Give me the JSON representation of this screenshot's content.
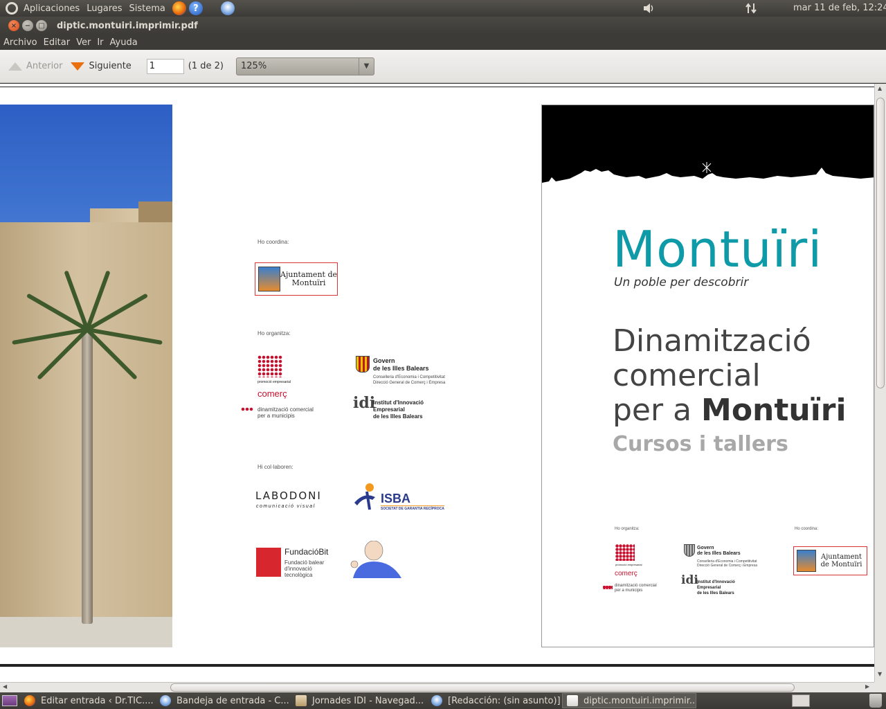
{
  "top_panel": {
    "menus": [
      "Aplicaciones",
      "Lugares",
      "Sistema"
    ],
    "help_icon_glyph": "?",
    "clock": "mar 11 de feb, 12:24"
  },
  "window": {
    "title": "diptic.montuiri.imprimir.pdf",
    "close_glyph": "×",
    "min_glyph": "−",
    "max_glyph": "□"
  },
  "menu_bar": [
    "Archivo",
    "Editar",
    "Ver",
    "Ir",
    "Ayuda"
  ],
  "toolbar": {
    "prev_label": "Anterior",
    "next_label": "Siguiente",
    "page_value": "1",
    "page_count": "(1 de 2)",
    "zoom": "125%",
    "zoom_arrow_glyph": "▼"
  },
  "left_page": {
    "coordina_label": "Ho coordina:",
    "ajuntament_logo_text": "Ajuntament de Montuïri",
    "organitza_label": "Ho organitza:",
    "promocio": "promoció empresarial",
    "comerc": "comerç",
    "dinamitzacio_small_1": "dinamització comercial",
    "dinamitzacio_small_2": "per a municipis",
    "govern_1": "Govern",
    "govern_2": "de les Illes Balears",
    "conselleria": "Conselleria d'Economia i Competitivitat",
    "direccio": "Direcció General de Comerç i Empresa",
    "idi_mark": "idi",
    "idi_1": "Institut d'Innovació",
    "idi_2": "Empresarial",
    "idi_3": "de les Illes Balears",
    "col_label": "Hi col·laboren:",
    "labodoni": "LABODONI",
    "labodoni_sub": "comunicació visual",
    "isba": "ISBA",
    "isba_sub": "SOCIETAT DE GARANTIA RECÍPROCA",
    "fundaciobit": "FundacióBit",
    "fundaciobit_sub_1": "Fundació balear",
    "fundaciobit_sub_2": "d'innovació",
    "fundaciobit_sub_3": "tecnològica"
  },
  "cover": {
    "title": "Montuïri",
    "subtitle": "Un poble per descobrir",
    "line1": "Dinamització",
    "line2": "comercial",
    "line3_pre": "per a ",
    "line3_bold": "Montuïri",
    "cursos": "Cursos i tallers",
    "organitza_label": "Ho organitza:",
    "coordina_label": "Ho coordina:",
    "promocio": "promoció empresarial",
    "comerc": "comerç",
    "dinamitzacio_small_1": "dinamització comercial",
    "dinamitzacio_small_2": "per a municipis",
    "govern_1": "Govern",
    "govern_2": "de les Illes Balears",
    "conselleria": "Conselleria d'Economia i Competitivitat",
    "direccio": "Direcció General de Comerç i Empresa",
    "idi_mark": "idi",
    "idi_1": "Institut d'Innovació",
    "idi_2": "Empresarial",
    "idi_3": "de les Illes Balears",
    "ajuntament_logo_text": "Ajuntament de Montuïri"
  },
  "scrollbars": {
    "up_glyph": "▲",
    "down_glyph": "▼",
    "left_glyph": "◀",
    "right_glyph": "▶"
  },
  "taskbar": [
    {
      "label": "Editar entrada ‹ Dr.TIC....",
      "icon": "firefox-icon",
      "active": false
    },
    {
      "label": "Bandeja de entrada - C...",
      "icon": "thunderbird-icon",
      "active": false
    },
    {
      "label": "Jornades IDI - Navegad...",
      "icon": "file-browser-icon",
      "active": false
    },
    {
      "label": "[Redacción: (sin asunto)]",
      "icon": "thunderbird-icon",
      "active": false
    },
    {
      "label": "diptic.montuiri.imprimir....",
      "icon": "document-viewer-icon",
      "active": true
    }
  ],
  "colors": {
    "montuiri_teal": "#0f9aa8",
    "comerc_red": "#c8102e",
    "panel_dark": "#3c3b37"
  }
}
